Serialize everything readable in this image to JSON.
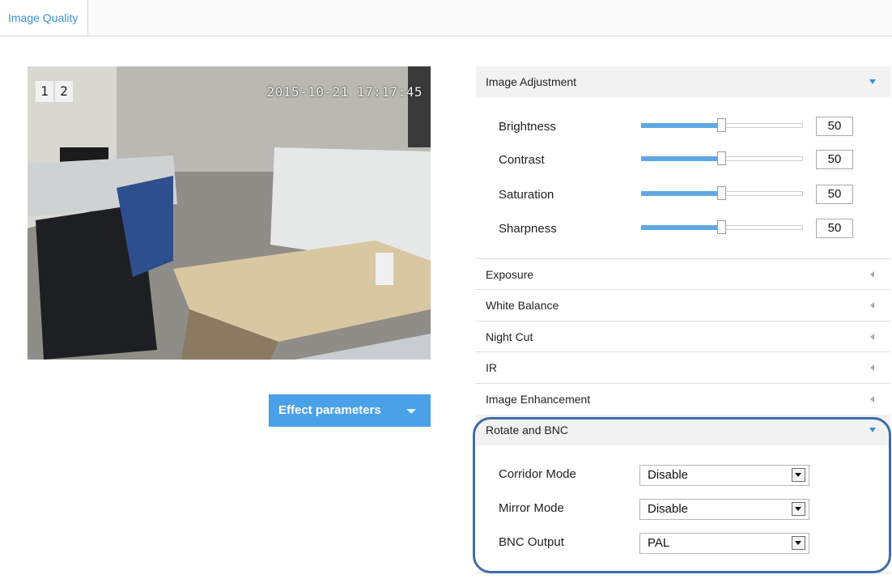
{
  "tab": {
    "label": "Image Quality"
  },
  "video": {
    "channel_labels": [
      "1",
      "2"
    ],
    "timestamp": "2015-10-21 17:17:45"
  },
  "effect_button": {
    "label": "Effect parameters"
  },
  "sections": {
    "image_adjustment": {
      "title": "Image Adjustment",
      "sliders": [
        {
          "label": "Brightness",
          "value": "50",
          "fraction": 0.5
        },
        {
          "label": "Contrast",
          "value": "50",
          "fraction": 0.5
        },
        {
          "label": "Saturation",
          "value": "50",
          "fraction": 0.5
        },
        {
          "label": "Sharpness",
          "value": "50",
          "fraction": 0.5
        }
      ]
    },
    "exposure": {
      "title": "Exposure"
    },
    "white_balance": {
      "title": "White Balance"
    },
    "night_cut": {
      "title": "Night Cut"
    },
    "ir": {
      "title": "IR"
    },
    "image_enhancement": {
      "title": "Image Enhancement"
    },
    "rotate_bnc": {
      "title": "Rotate and BNC",
      "fields": [
        {
          "label": "Corridor Mode",
          "value": "Disable"
        },
        {
          "label": "Mirror Mode",
          "value": "Disable"
        },
        {
          "label": "BNC Output",
          "value": "PAL"
        }
      ]
    }
  },
  "colors": {
    "accent": "#4aa1e8",
    "link": "#3a8fd4",
    "highlight_border": "#3b6ea8"
  }
}
